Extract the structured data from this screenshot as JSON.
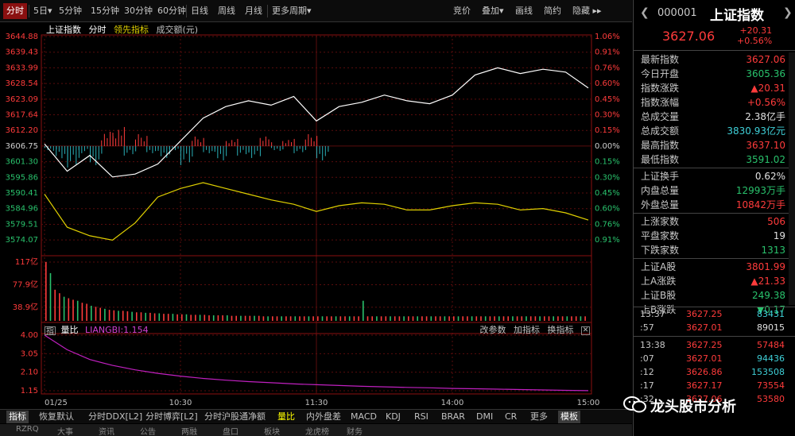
{
  "toolbar": {
    "left": [
      "分时",
      "5日▾",
      "5分钟",
      "15分钟",
      "30分钟",
      "60分钟",
      "日线",
      "周线",
      "月线",
      "更多周期▾"
    ],
    "right": [
      "竞价",
      "叠加▾",
      "画线",
      "简约",
      "隐藏 ▸▸"
    ]
  },
  "legend": {
    "name": "上证指数",
    "period": "分时",
    "leading": "领先指标",
    "amount": "成交额(元)"
  },
  "colors": {
    "up": "#ff3b3b",
    "down": "#29c26c",
    "price_line": "#ffffff",
    "avg_line": "#e0d000",
    "neg_bar": "#2ab0b8",
    "ratio_line": "#c020c0",
    "active_tab": "#8a1010"
  },
  "chart_data": [
    {
      "type": "line",
      "title": "上证指数 分时",
      "pre_close": 3606.75,
      "y_tick_labels": [
        "3644.88",
        "3639.43",
        "3633.99",
        "3628.54",
        "3623.09",
        "3617.64",
        "3612.20",
        "3606.75",
        "3601.30",
        "3595.86",
        "3590.41",
        "3584.96",
        "3579.51",
        "3574.07"
      ],
      "pct_tick_labels": [
        "1.06%",
        "0.91%",
        "0.76%",
        "0.60%",
        "0.45%",
        "0.30%",
        "0.15%",
        "0.00%",
        "0.15%",
        "0.30%",
        "0.45%",
        "0.60%",
        "0.76%",
        "0.91%"
      ],
      "x_tick_labels": [
        "01/25",
        "10:30",
        "11:30",
        "14:00",
        "15:00"
      ],
      "x": [
        0,
        5,
        10,
        15,
        20,
        25,
        30,
        35,
        40,
        45,
        50,
        55,
        60,
        65,
        70,
        75,
        80,
        85,
        90,
        95,
        100,
        105,
        110,
        115,
        120
      ],
      "series": [
        {
          "name": "价格",
          "values": [
            3607.5,
            3598.0,
            3603.5,
            3596.0,
            3597.0,
            3600.5,
            3608.5,
            3616.5,
            3620.5,
            3622.5,
            3621.0,
            3624.0,
            3615.5,
            3620.5,
            3622.0,
            3624.5,
            3622.5,
            3621.5,
            3624.5,
            3631.5,
            3634.0,
            3632.0,
            3633.5,
            3632.5,
            3627.0
          ]
        },
        {
          "name": "领先指标",
          "values": [
            3590.0,
            3578.5,
            3575.5,
            3574.0,
            3580.0,
            3589.0,
            3592.0,
            3594.0,
            3592.0,
            3590.0,
            3588.0,
            3586.5,
            3584.0,
            3586.0,
            3587.0,
            3586.5,
            3584.5,
            3584.5,
            3586.0,
            3587.0,
            3586.5,
            3584.5,
            3585.0,
            3583.5,
            3581.0
          ]
        }
      ],
      "diff_bars": {
        "note": "red above 0 / cyan below 0",
        "values": [
          -2,
          -6,
          -9,
          -3,
          -8,
          6,
          8,
          -4,
          5,
          -3,
          -5,
          -2,
          -8,
          4,
          -3,
          -6,
          3,
          -4,
          -5,
          4,
          -2,
          3,
          -3,
          5,
          -6
        ]
      }
    },
    {
      "type": "bar",
      "title": "成交额",
      "y_tick_labels": [
        "117亿",
        "77.9亿",
        "38.9亿"
      ],
      "ylim": [
        0,
        117
      ],
      "values": [
        117,
        95,
        62,
        55,
        48,
        45,
        42,
        40,
        36,
        34,
        30,
        28,
        26,
        24,
        22,
        21,
        20,
        20,
        19,
        18,
        17,
        17,
        16,
        16,
        15,
        15,
        14,
        14,
        14,
        13,
        13,
        13,
        12,
        12,
        12,
        12,
        11,
        11,
        11,
        11,
        11,
        10,
        10,
        10,
        10,
        10,
        10,
        10,
        9,
        9,
        9,
        9,
        9,
        9,
        9,
        9,
        9,
        9,
        9,
        9,
        9,
        9,
        9,
        9,
        9,
        9,
        9,
        9,
        9,
        9,
        40,
        9,
        9,
        9,
        9,
        9,
        9,
        9,
        9,
        9,
        9,
        9,
        9,
        9,
        9,
        9,
        9,
        9,
        9,
        9,
        9,
        9,
        9,
        9,
        9,
        9,
        9,
        9,
        9,
        9,
        9,
        9,
        9,
        9,
        9,
        9,
        9,
        9,
        9,
        9,
        9,
        9,
        9,
        9,
        9,
        9,
        9,
        9,
        9,
        9
      ]
    },
    {
      "type": "line",
      "title": "量比",
      "indicator_label": "LIANGBI:1.154",
      "y_tick_labels": [
        "4.00",
        "3.05",
        "2.10",
        "1.15"
      ],
      "ylim": [
        1.15,
        4.0
      ],
      "x": [
        0,
        5,
        10,
        15,
        20,
        25,
        30,
        35,
        40,
        45,
        50,
        55,
        60,
        65,
        70,
        75,
        80,
        85,
        90,
        95,
        100,
        105,
        110,
        115,
        120
      ],
      "series": [
        {
          "name": "LIANGBI",
          "values": [
            4.0,
            3.25,
            2.75,
            2.45,
            2.22,
            2.04,
            1.9,
            1.78,
            1.69,
            1.62,
            1.56,
            1.5,
            1.46,
            1.42,
            1.38,
            1.35,
            1.32,
            1.3,
            1.27,
            1.25,
            1.23,
            1.21,
            1.19,
            1.17,
            1.154
          ]
        }
      ]
    }
  ],
  "panel3": {
    "label_index": "指",
    "label_ratio": "量比",
    "right_buttons": [
      "改参数",
      "加指标",
      "换指标"
    ],
    "close": "✕"
  },
  "bottom_tabs": [
    "指标",
    "恢复默认",
    "分时DDX[L2]",
    "分时博弈[L2]",
    "分时沪股通净额",
    "量比",
    "内外盘差",
    "MACD",
    "KDJ",
    "RSI",
    "BRAR",
    "DMI",
    "CR",
    "更多",
    "模板"
  ],
  "bottom_strip": [
    "RZRQ",
    "大事",
    "资讯",
    "公告",
    "两融",
    "盘口",
    "板块",
    "龙虎榜",
    "财务"
  ],
  "right_panel": {
    "code": "000001",
    "name": "上证指数",
    "price": "3627.06",
    "change": "+20.31",
    "change_pct": "+0.56%",
    "stats": [
      {
        "k": "最新指数",
        "v": "3627.06",
        "c": "red"
      },
      {
        "k": "今日开盘",
        "v": "3605.36",
        "c": "green"
      },
      {
        "k": "指数涨跌",
        "v": "▲20.31",
        "c": "red"
      },
      {
        "k": "指数涨幅",
        "v": "+0.56%",
        "c": "red"
      },
      {
        "k": "总成交量",
        "v": "2.38亿手",
        "c": "white"
      },
      {
        "k": "总成交额",
        "v": "3830.93亿元",
        "c": "cyan"
      },
      {
        "k": "最高指数",
        "v": "3637.10",
        "c": "red"
      },
      {
        "k": "最低指数",
        "v": "3591.02",
        "c": "green"
      },
      {
        "k": "上证换手",
        "v": "0.62%",
        "c": "white",
        "sep": true
      },
      {
        "k": "内盘总量",
        "v": "12993万手",
        "c": "green"
      },
      {
        "k": "外盘总量",
        "v": "10842万手",
        "c": "red"
      },
      {
        "k": "上涨家数",
        "v": "506",
        "c": "red",
        "sep": true
      },
      {
        "k": "平盘家数",
        "v": "19",
        "c": "white"
      },
      {
        "k": "下跌家数",
        "v": "1313",
        "c": "green"
      },
      {
        "k": "上证A股",
        "v": "3801.99",
        "c": "red",
        "sep": true
      },
      {
        "k": "上A涨跌",
        "v": "▲21.33",
        "c": "red"
      },
      {
        "k": "上证B股",
        "v": "249.38",
        "c": "green"
      },
      {
        "k": "上B涨跌",
        "v": "▼0.17",
        "c": "green"
      }
    ],
    "ticks": [
      {
        "t": "13:37",
        "p": "3627.25",
        "q": "83431",
        "qc": "cyan"
      },
      {
        "t": ":57",
        "p": "3627.01",
        "q": "89015",
        "qc": "white"
      },
      {
        "t": "13:38",
        "p": "3627.25",
        "q": "57484",
        "qc": "red",
        "div": true
      },
      {
        "t": ":07",
        "p": "3627.01",
        "q": "94436",
        "qc": "cyan"
      },
      {
        "t": ":12",
        "p": "3626.86",
        "q": "153508",
        "qc": "cyan"
      },
      {
        "t": ":17",
        "p": "3627.17",
        "q": "73554",
        "qc": "red"
      },
      {
        "t": ":32",
        "p": "3627.06",
        "q": "53580",
        "qc": "red"
      }
    ]
  },
  "watermark": "龙头股市分析"
}
